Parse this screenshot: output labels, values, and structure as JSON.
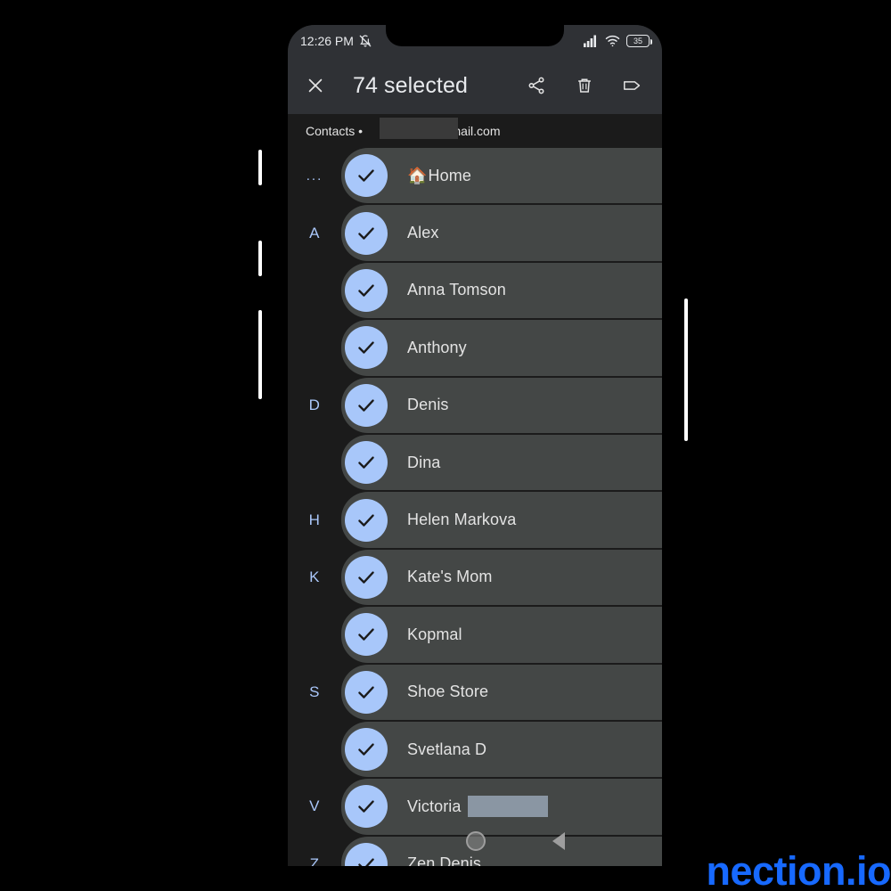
{
  "status_bar": {
    "time": "12:26 PM",
    "alarm_icon": "notifications-off-icon",
    "signal_icon": "cellular-signal-icon",
    "wifi_icon": "wifi-icon",
    "battery_level": "35"
  },
  "app_bar": {
    "close_icon": "close-icon",
    "title": "74 selected",
    "share_icon": "share-icon",
    "delete_icon": "trash-icon",
    "label_icon": "label-tag-icon"
  },
  "account": {
    "prefix": "Contacts •",
    "email_suffix": ")gmail.com"
  },
  "contacts": [
    {
      "index": "...",
      "name": "Home",
      "emoji": "🏠",
      "selected": true,
      "redacted": false
    },
    {
      "index": "A",
      "name": "Alex",
      "emoji": "",
      "selected": true,
      "redacted": false
    },
    {
      "index": "",
      "name": "Anna Tomson",
      "emoji": "",
      "selected": true,
      "redacted": false
    },
    {
      "index": "",
      "name": "Anthony",
      "emoji": "",
      "selected": true,
      "redacted": false
    },
    {
      "index": "D",
      "name": "Denis",
      "emoji": "",
      "selected": true,
      "redacted": false
    },
    {
      "index": "",
      "name": "Dina",
      "emoji": "",
      "selected": true,
      "redacted": false
    },
    {
      "index": "H",
      "name": "Helen Markova",
      "emoji": "",
      "selected": true,
      "redacted": false
    },
    {
      "index": "K",
      "name": "Kate's Mom",
      "emoji": "",
      "selected": true,
      "redacted": false
    },
    {
      "index": "",
      "name": "Kopmal",
      "emoji": "",
      "selected": true,
      "redacted": false
    },
    {
      "index": "S",
      "name": "Shoe Store",
      "emoji": "",
      "selected": true,
      "redacted": false
    },
    {
      "index": "",
      "name": "Svetlana D",
      "emoji": "",
      "selected": true,
      "redacted": false
    },
    {
      "index": "V",
      "name": "Victoria",
      "emoji": "",
      "selected": true,
      "redacted": true
    },
    {
      "index": "Z",
      "name": "Zen Denis",
      "emoji": "",
      "selected": true,
      "redacted": false
    }
  ],
  "nav_bar": {
    "home_icon": "home-circle-icon",
    "back_icon": "back-triangle-icon"
  },
  "watermark": {
    "text": "nection.io",
    "color": "#1769ff"
  },
  "colors": {
    "accent_check": "#a8c7fa",
    "row_background": "#444746",
    "screen_background": "#1b1b1b",
    "bar_background": "#2f3135",
    "index_letter": "#aac7fa",
    "text_primary": "#e3e3e3"
  }
}
